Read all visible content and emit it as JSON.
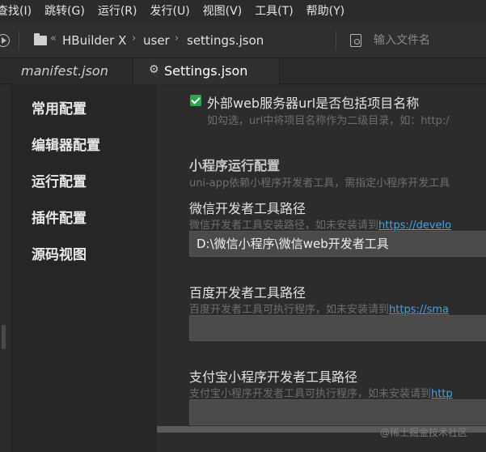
{
  "menu": [
    "查找(I)",
    "跳转(G)",
    "运行(R)",
    "发行(U)",
    "视图(V)",
    "工具(T)",
    "帮助(Y)"
  ],
  "toolbar": {
    "breadcrumb": [
      "HBuilder X",
      "user",
      "settings.json"
    ],
    "file_search_placeholder": "输入文件名"
  },
  "tabs": [
    {
      "label": "manifest.json",
      "active": false
    },
    {
      "label": "Settings.json",
      "active": true
    }
  ],
  "settings_nav": [
    "常用配置",
    "编辑器配置",
    "运行配置",
    "插件配置",
    "源码视图"
  ],
  "content": {
    "web_server": {
      "checked": true,
      "label": "外部web服务器url是否包括项目名称",
      "desc": "如勾选，url中将项目名称作为二级目录，如：http:/"
    },
    "mp_section": {
      "title": "小程序运行配置",
      "desc": "uni-app依赖小程序开发者工具，需指定小程序开发工具"
    },
    "wechat": {
      "label": "微信开发者工具路径",
      "desc_prefix": "微信开发者工具安装路径，如未安装请到",
      "link": "https://develo",
      "value": "D:\\微信小程序\\微信web开发者工具"
    },
    "baidu": {
      "label": "百度开发者工具路径",
      "desc_prefix": "百度开发者工具可执行程序，如未安装请到",
      "link": "https://sma",
      "value": ""
    },
    "alipay": {
      "label": "支付宝小程序开发者工具路径",
      "desc_prefix": "支付宝小程序开发者工具可执行程序，如未安装请到",
      "link": "http",
      "value": ""
    }
  },
  "watermark": "@稀土掘金技术社区",
  "colors": {
    "checkbox": "#2ea44f",
    "link": "#4aa3df",
    "accent_bg": "#2c2c2c"
  }
}
